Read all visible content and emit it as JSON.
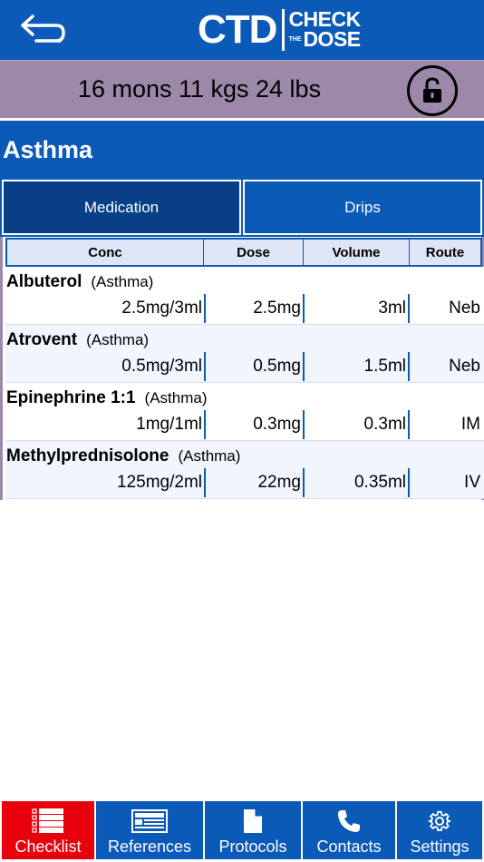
{
  "header": {
    "logo_main": "CTD",
    "logo_check": "CHECK",
    "logo_the": "THE",
    "logo_dose": "DOSE",
    "back_icon": "back-arrow-icon"
  },
  "patient": {
    "summary": "16 mons 11 kgs 24 lbs",
    "lock_icon": "unlock-icon"
  },
  "section": {
    "title": "Asthma"
  },
  "tabs": [
    {
      "label": "Medication",
      "active": true
    },
    {
      "label": "Drips",
      "active": false
    }
  ],
  "table": {
    "columns": [
      "Conc",
      "Dose",
      "Volume",
      "Route"
    ],
    "rows": [
      {
        "name": "Albuterol",
        "indication": "(Asthma)",
        "conc": "2.5mg/3ml",
        "dose": "2.5mg",
        "volume": "3ml",
        "route": "Neb"
      },
      {
        "name": "Atrovent",
        "indication": "(Asthma)",
        "conc": "0.5mg/3ml",
        "dose": "0.5mg",
        "volume": "1.5ml",
        "route": "Neb"
      },
      {
        "name": "Epinephrine 1:1",
        "indication": "(Asthma)",
        "conc": "1mg/1ml",
        "dose": "0.3mg",
        "volume": "0.3ml",
        "route": "IM"
      },
      {
        "name": "Methylprednisolone",
        "indication": "(Asthma)",
        "conc": "125mg/2ml",
        "dose": "22mg",
        "volume": "0.35ml",
        "route": "IV"
      }
    ]
  },
  "nav": [
    {
      "label": "Checklist",
      "icon": "checklist-icon",
      "active": true
    },
    {
      "label": "References",
      "icon": "references-icon",
      "active": false
    },
    {
      "label": "Protocols",
      "icon": "document-icon",
      "active": false
    },
    {
      "label": "Contacts",
      "icon": "phone-icon",
      "active": false
    },
    {
      "label": "Settings",
      "icon": "gear-icon",
      "active": false
    }
  ],
  "colors": {
    "primary": "#0b5ab8",
    "primary_dark": "#083f87",
    "patient_bar": "#9c88a8",
    "active_nav": "#e8000d"
  }
}
